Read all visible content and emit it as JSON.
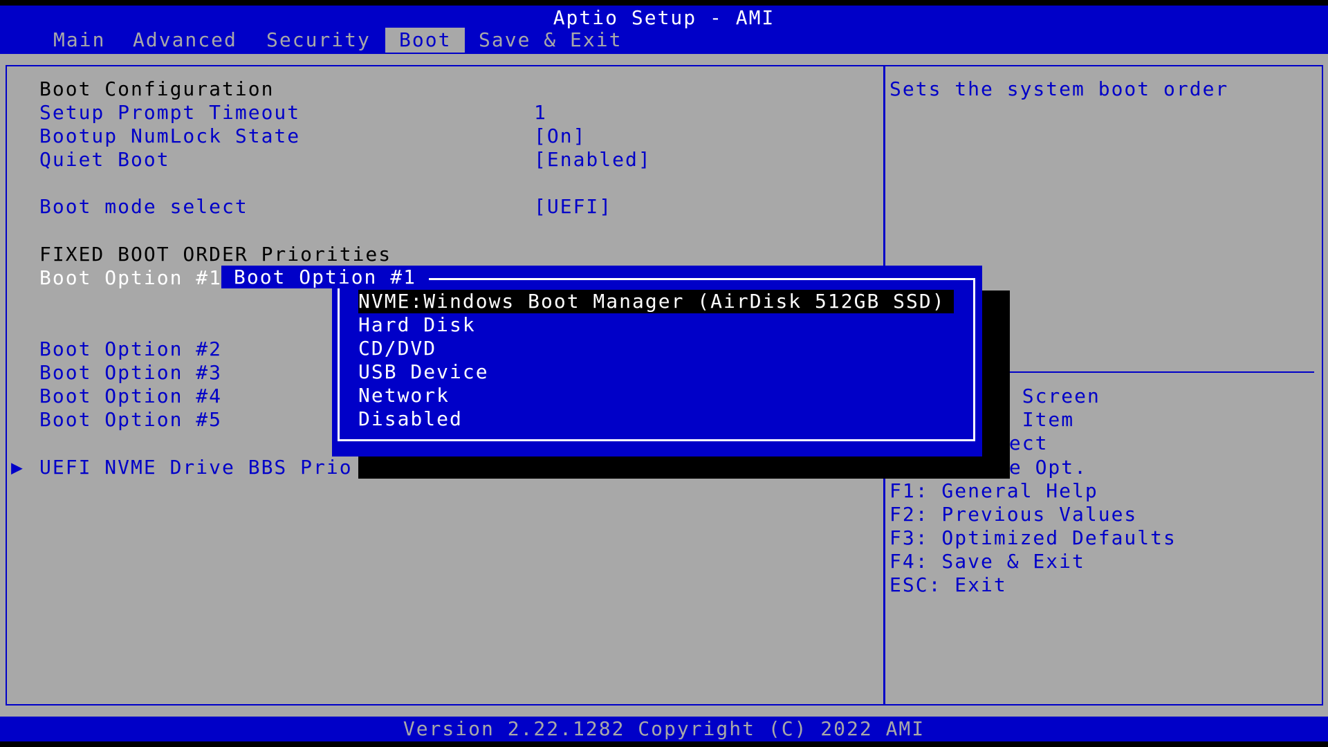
{
  "title": "Aptio Setup - AMI",
  "tabs": [
    "Main",
    "Advanced",
    "Security",
    "Boot",
    "Save & Exit"
  ],
  "active_tab": "Boot",
  "settings": {
    "boot_configuration_header": "Boot Configuration",
    "setup_prompt_timeout": {
      "label": "Setup Prompt Timeout",
      "value": "1"
    },
    "bootup_numlock": {
      "label": "Bootup NumLock State",
      "value": "[On]"
    },
    "quiet_boot": {
      "label": "Quiet Boot",
      "value": "[Enabled]"
    },
    "boot_mode": {
      "label": "Boot mode select",
      "value": "[UEFI]"
    },
    "fixed_order_header": "FIXED BOOT ORDER Priorities",
    "boot_options": [
      "Boot Option #1",
      "Boot Option #2",
      "Boot Option #3",
      "Boot Option #4",
      "Boot Option #5"
    ],
    "nvme_submenu": "UEFI NVME Drive BBS Prio"
  },
  "popup": {
    "title": "Boot Option #1",
    "options": [
      "NVME:Windows Boot Manager (AirDisk 512GB SSD)",
      "Hard Disk",
      "CD/DVD",
      "USB Device",
      "Network",
      "Disabled"
    ],
    "selected_index": 0
  },
  "help": {
    "description": "Sets the system boot order",
    "keys_partial": [
      "t Screen",
      "t Item",
      "lect",
      "ge Opt."
    ],
    "keys": [
      "F1: General Help",
      "F2: Previous Values",
      "F3: Optimized Defaults",
      "F4: Save & Exit",
      "ESC: Exit"
    ]
  },
  "footer": "Version 2.22.1282 Copyright (C) 2022 AMI",
  "colors": {
    "blue": "#0000c8",
    "gray": "#a8a8a8",
    "white": "#ffffff",
    "black": "#000000"
  }
}
